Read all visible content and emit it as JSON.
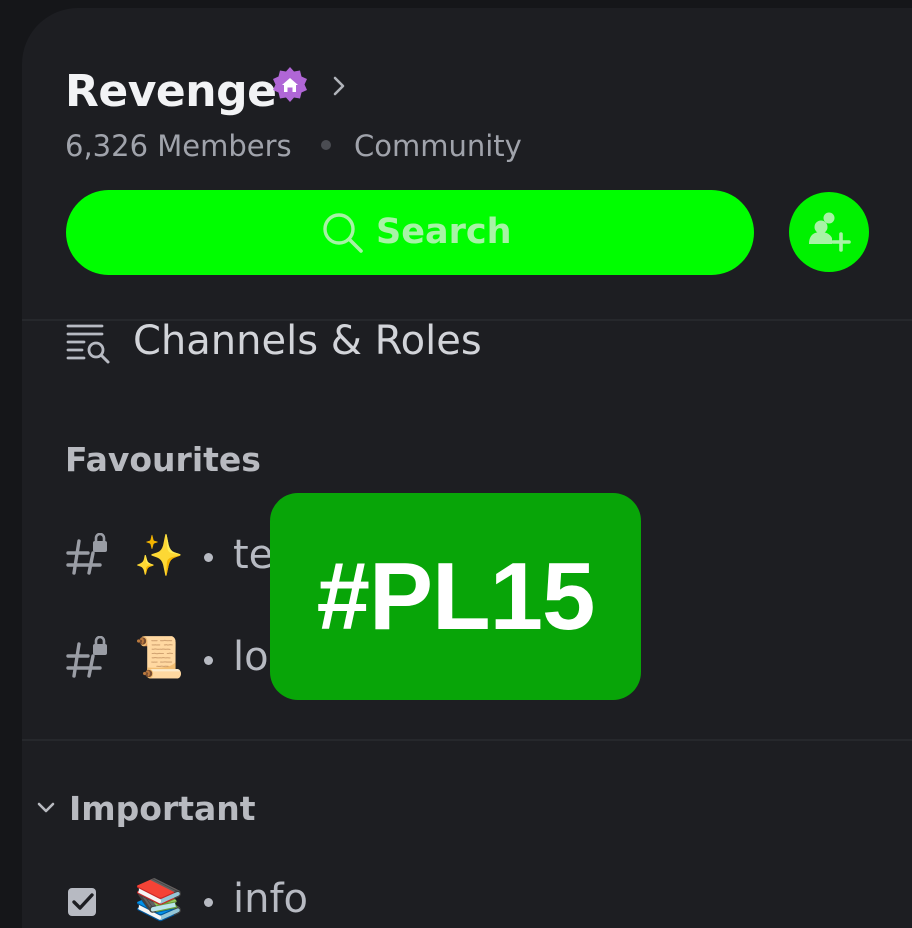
{
  "server": {
    "name": "Revenge",
    "members": "6,326 Members",
    "type": "Community"
  },
  "search": {
    "label": "Search"
  },
  "channels_roles": {
    "label": "Channels & Roles"
  },
  "favourites": {
    "heading": "Favourites",
    "channels": [
      {
        "emoji": "✨",
        "name": "team"
      },
      {
        "emoji": "📜",
        "name": "logs"
      }
    ]
  },
  "important": {
    "heading": "Important",
    "channels": [
      {
        "emoji": "📚",
        "name": "info"
      }
    ]
  },
  "overlay_tag": "#PL15",
  "colors": {
    "background": "#1d1e22",
    "search_green": "#00fe00",
    "overlay_green": "#08a508",
    "boost_badge": "#b066d6"
  }
}
